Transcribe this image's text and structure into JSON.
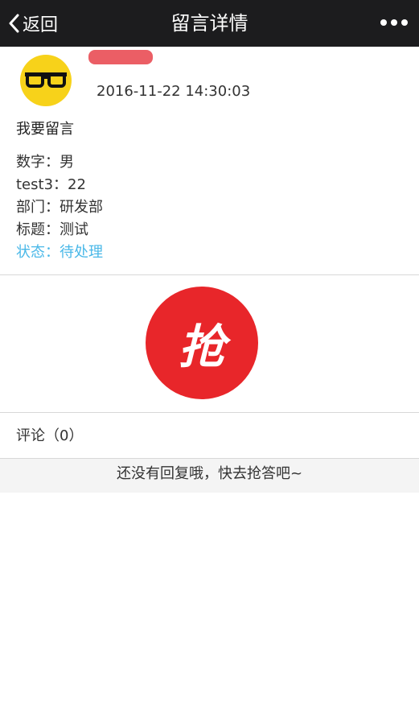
{
  "navbar": {
    "back_label": "返回",
    "title": "留言详情",
    "more_icon": "more-dots-icon",
    "background": "#1c1c1e"
  },
  "post": {
    "avatar_icon": "glasses-avatar-icon",
    "avatar_color": "#f7d21a",
    "time": "2016-11-22 14:30:03",
    "text": "我要留言",
    "fields": [
      {
        "label": "数字：",
        "value": "男"
      },
      {
        "label": "test3：",
        "value": "22"
      },
      {
        "label": "部门：",
        "value": "研发部"
      },
      {
        "label": "标题：",
        "value": "测试"
      }
    ],
    "status": {
      "label": "状态：",
      "value": "待处理",
      "color": "#4ab8e8"
    }
  },
  "grab_button": {
    "label": "抢",
    "color": "#e8262a"
  },
  "comments": {
    "header": "评论（0）",
    "empty_text": "还没有回复哦，快去抢答吧~"
  }
}
